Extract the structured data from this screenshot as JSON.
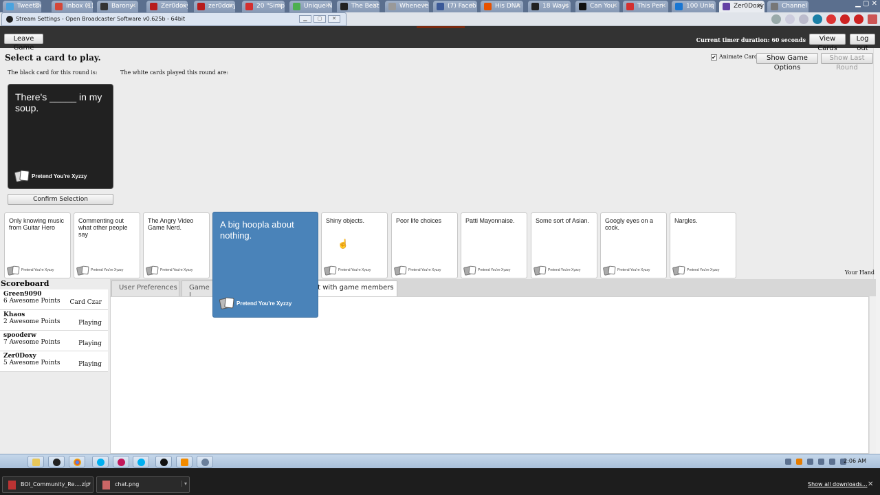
{
  "browser": {
    "tabs": [
      {
        "label": "TweetDe",
        "color": "#4aa3df"
      },
      {
        "label": "Inbox (1)",
        "color": "#d44638"
      },
      {
        "label": "Barony",
        "color": "#333333"
      },
      {
        "label": "Zer0doxy",
        "color": "#b71c1c"
      },
      {
        "label": "zer0doxy",
        "color": "#b71c1c"
      },
      {
        "label": "20 \"Simp",
        "color": "#d32f2f"
      },
      {
        "label": "Unique N",
        "color": "#4caf50"
      },
      {
        "label": "The Beat",
        "color": "#222222"
      },
      {
        "label": "Wheneve",
        "color": "#999999"
      },
      {
        "label": "(7) Faceb",
        "color": "#3b5998"
      },
      {
        "label": "His DNA",
        "color": "#e65100"
      },
      {
        "label": "18 Ways",
        "color": "#222222"
      },
      {
        "label": "Can You",
        "color": "#111111"
      },
      {
        "label": "This Pen",
        "color": "#d32f2f"
      },
      {
        "label": "100 Uniq",
        "color": "#1976d2"
      },
      {
        "label": "Zer0Doxy",
        "color": "#6441a5",
        "active": true
      },
      {
        "label": "Channel",
        "color": "#777777"
      }
    ],
    "obs_title": "Stream Settings - Open Broadcaster Software v0.625b - 64bit"
  },
  "header": {
    "leave_game": "Leave Game",
    "timer": "Current timer duration: 60 seconds",
    "view_cards": "View Cards",
    "log_out": "Log out"
  },
  "game": {
    "title": "Select a card to play.",
    "black_card_label": "The black card for this round is:",
    "white_cards_label": "The white cards played this round are:",
    "animate_cards": "Animate Cards",
    "animate_checked": "✔",
    "show_game_options": "Show Game Options",
    "show_last_round": "Show Last Round",
    "black_card": {
      "text": "There's _____ in my soup.",
      "brand": "Pretend You're Xyzzy"
    },
    "confirm": "Confirm Selection",
    "your_hand": "Your Hand",
    "hand": [
      {
        "text": "Only knowing music from Guitar Hero",
        "brand": "Pretend You're Xyzzy"
      },
      {
        "text": "Commenting out what other people say",
        "brand": "Pretend You're Xyzzy"
      },
      {
        "text": "The Angry Video Game Nerd.",
        "brand": "Pretend You're Xyzzy"
      },
      {
        "text": "Shiny objects.",
        "brand": "Pretend You're Xyzzy"
      },
      {
        "text": "Poor life choices",
        "brand": "Pretend You're Xyzzy"
      },
      {
        "text": "Patti Mayonnaise.",
        "brand": "Pretend You're Xyzzy"
      },
      {
        "text": "Some sort of Asian.",
        "brand": "Pretend You're Xyzzy"
      },
      {
        "text": "Googly eyes on a cock.",
        "brand": "Pretend You're Xyzzy"
      },
      {
        "text": "Nargles.",
        "brand": "Pretend You're Xyzzy"
      }
    ],
    "selected_card": {
      "text": "A big hoopla about nothing.",
      "brand": "Pretend You're Xyzzy"
    }
  },
  "scoreboard": {
    "title": "Scoreboard",
    "players": [
      {
        "name": "Green9090",
        "points": "6 Awesome Points",
        "status": "Card Czar"
      },
      {
        "name": "Khaos",
        "points": "2 Awesome Points",
        "status": "Playing"
      },
      {
        "name": "spooderw",
        "points": "7 Awesome Points",
        "status": "Playing"
      },
      {
        "name": "Zer0Doxy",
        "points": "5 Awesome Points",
        "status": "Playing"
      }
    ]
  },
  "panel_tabs": {
    "user_prefs": "User Preferences",
    "game_list": "Game L",
    "chat": "at with game members"
  },
  "taskbar": {
    "clock": "2:06 AM"
  },
  "downloads": {
    "items": [
      "BOI_Community_Re....zip",
      "chat.png"
    ],
    "show_all": "Show all downloads..."
  }
}
